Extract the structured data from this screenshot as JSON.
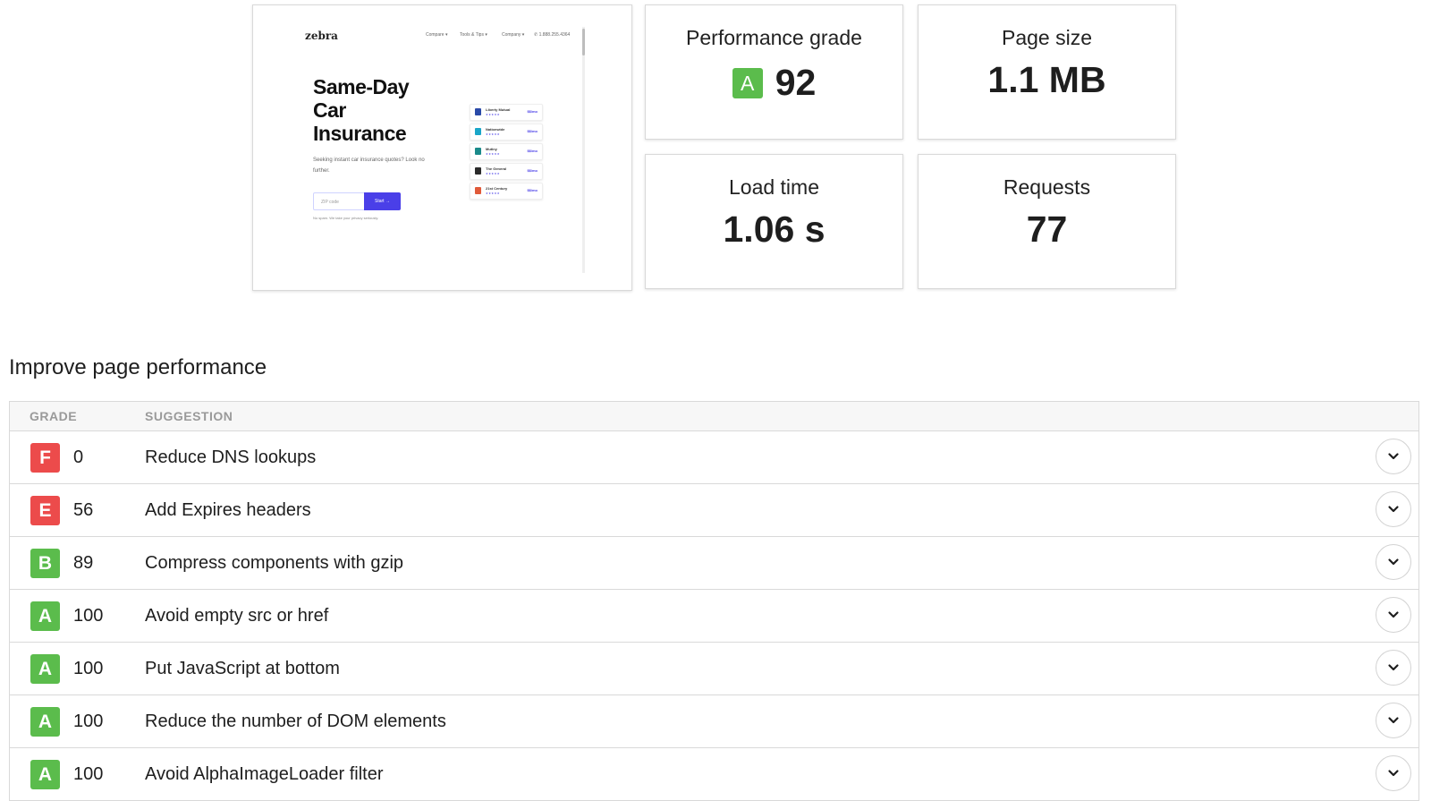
{
  "preview": {
    "logo": "zebra",
    "nav": [
      "Compare ▾",
      "Tools & Tips ▾",
      "Company ▾",
      "✆ 1.888.255.4364"
    ],
    "hero": [
      "Same-Day",
      "Car",
      "Insurance"
    ],
    "sub": "Seeking instant car insurance quotes? Look no further.",
    "zip_placeholder": "ZIP code",
    "start_label": "Start →",
    "privacy": "No spam. We take your privacy seriously.",
    "quotes": [
      {
        "name": "Liberty Mutual",
        "price": "$$/mo",
        "color": "#2a4aa8"
      },
      {
        "name": "Nationwide",
        "price": "$$/mo",
        "color": "#1aa6c8"
      },
      {
        "name": "Mutiny",
        "price": "$$/mo",
        "color": "#1a8a8a"
      },
      {
        "name": "The General",
        "price": "$$/mo",
        "color": "#2b2b2b"
      },
      {
        "name": "21st Century",
        "price": "$$/mo",
        "color": "#e05a3a"
      }
    ]
  },
  "metrics": {
    "performance": {
      "label": "Performance grade",
      "grade": "A",
      "value": "92"
    },
    "page_size": {
      "label": "Page size",
      "value": "1.1 MB"
    },
    "load_time": {
      "label": "Load time",
      "value": "1.06 s"
    },
    "requests": {
      "label": "Requests",
      "value": "77"
    }
  },
  "section": {
    "title": "Improve page performance"
  },
  "table": {
    "headers": {
      "grade": "GRADE",
      "suggestion": "SUGGESTION"
    },
    "rows": [
      {
        "grade": "F",
        "score": "0",
        "text": "Reduce DNS lookups",
        "color": "#ec4b4b"
      },
      {
        "grade": "E",
        "score": "56",
        "text": "Add Expires headers",
        "color": "#ec4b4b"
      },
      {
        "grade": "B",
        "score": "89",
        "text": "Compress components with gzip",
        "color": "#5bbc4c"
      },
      {
        "grade": "A",
        "score": "100",
        "text": "Avoid empty src or href",
        "color": "#5bbc4c"
      },
      {
        "grade": "A",
        "score": "100",
        "text": "Put JavaScript at bottom",
        "color": "#5bbc4c"
      },
      {
        "grade": "A",
        "score": "100",
        "text": "Reduce the number of DOM elements",
        "color": "#5bbc4c"
      },
      {
        "grade": "A",
        "score": "100",
        "text": "Avoid AlphaImageLoader filter",
        "color": "#5bbc4c"
      }
    ]
  },
  "icons": {
    "expand": "chevron-down-icon"
  }
}
